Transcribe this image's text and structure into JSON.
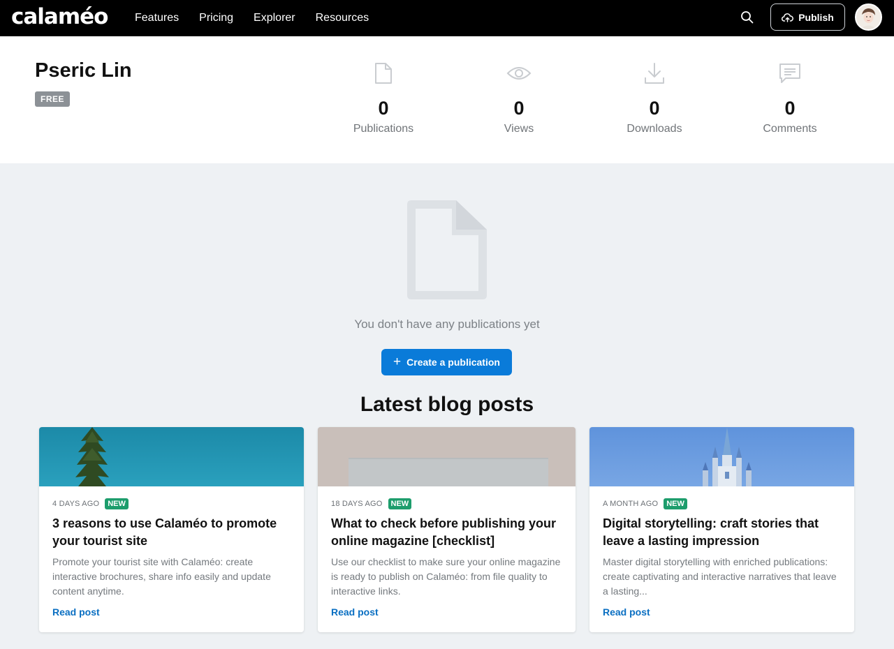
{
  "app": {
    "logo": "calaméo"
  },
  "nav": {
    "items": [
      "Features",
      "Pricing",
      "Explorer",
      "Resources"
    ],
    "publish_label": "Publish",
    "search_icon": "search-icon",
    "avatar_icon": "avatar"
  },
  "profile": {
    "name": "Pseric Lin",
    "plan": "FREE",
    "stats": [
      {
        "icon": "document-icon",
        "value": "0",
        "label": "Publications"
      },
      {
        "icon": "eye-icon",
        "value": "0",
        "label": "Views"
      },
      {
        "icon": "download-icon",
        "value": "0",
        "label": "Downloads"
      },
      {
        "icon": "comment-icon",
        "value": "0",
        "label": "Comments"
      }
    ]
  },
  "empty_state": {
    "message": "You don't have any publications yet",
    "create_label": "Create a publication",
    "create_icon": "+"
  },
  "blog": {
    "heading": "Latest blog posts",
    "posts": [
      {
        "date": "4 DAYS AGO",
        "badge": "NEW",
        "title": "3 reasons to use Calaméo to promote your tourist site",
        "excerpt": "Promote your tourist site with Calaméo: create interactive brochures, share info easily and update content anytime.",
        "link": "Read post"
      },
      {
        "date": "18 DAYS AGO",
        "badge": "NEW",
        "title": "What to check before publishing your online magazine [checklist]",
        "excerpt": "Use our checklist to make sure your online magazine is ready to publish on Calaméo: from file quality to interactive links.",
        "link": "Read post"
      },
      {
        "date": "A MONTH AGO",
        "badge": "NEW",
        "title": "Digital storytelling: craft stories that leave a lasting impression",
        "excerpt": "Master digital storytelling with enriched publications: create captivating and interactive narratives that leave a lasting...",
        "link": "Read post"
      }
    ]
  },
  "colors": {
    "topbar": "#000000",
    "accent": "#0a7bd9",
    "new_badge": "#1d9d6c",
    "link": "#0a6fc2",
    "page_bg": "#eef1f4"
  }
}
